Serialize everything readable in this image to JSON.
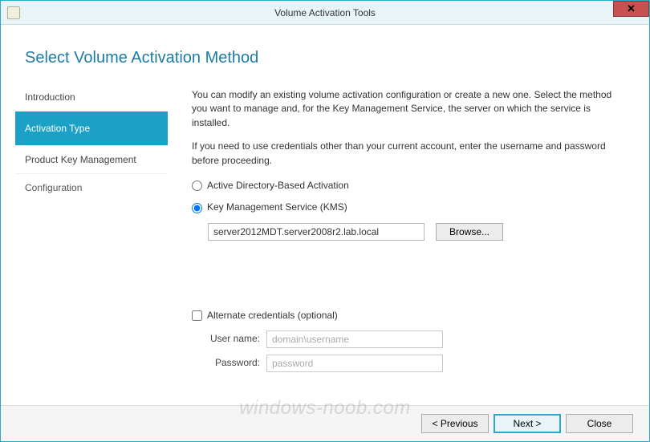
{
  "window": {
    "title": "Volume Activation Tools"
  },
  "page": {
    "title": "Select Volume Activation Method"
  },
  "sidebar": {
    "items": [
      {
        "label": "Introduction"
      },
      {
        "label": "Activation Type"
      },
      {
        "label": "Product Key Management"
      },
      {
        "label": "Configuration"
      }
    ]
  },
  "main": {
    "intro1": "You can modify an existing volume activation configuration or create a new one. Select the method you want to manage and, for the Key Management Service, the server on which the service is installed.",
    "intro2": "If you need to use credentials other than your current account, enter the username and password before proceeding.",
    "radios": {
      "adba": "Active Directory-Based Activation",
      "kms": "Key Management Service (KMS)"
    },
    "server_value": "server2012MDT.server2008r2.lab.local",
    "browse_label": "Browse...",
    "alt_creds_label": "Alternate credentials (optional)",
    "username_label": "User name:",
    "username_placeholder": "domain\\username",
    "password_label": "Password:",
    "password_placeholder": "password"
  },
  "footer": {
    "previous": "<  Previous",
    "next": "Next  >",
    "close": "Close"
  },
  "watermark": "windows-noob.com"
}
